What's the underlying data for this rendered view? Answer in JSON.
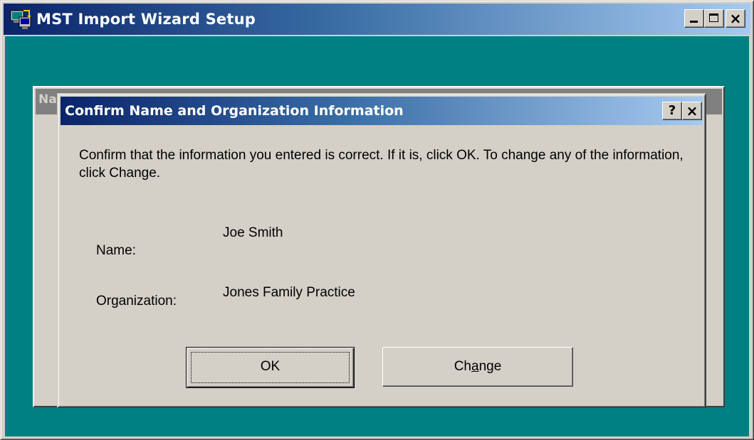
{
  "outer_window": {
    "title": "MST Import Wizard Setup",
    "app_icon": "setup-computer-icon",
    "minimize_icon": "minimize-icon",
    "maximize_icon": "maximize-icon",
    "close_icon": "close-icon",
    "close_glyph": "×"
  },
  "background_dialog": {
    "title_fragment": "Na"
  },
  "dialog": {
    "title": "Confirm Name and Organization Information",
    "help_glyph": "?",
    "close_glyph": "×",
    "help_icon": "help-icon",
    "close_icon": "close-icon",
    "message": "Confirm that the information you entered is correct. If it is, click OK. To change any of the information, click Change.",
    "fields": {
      "name_label": "Name:",
      "name_value": "Joe Smith",
      "organization_label": "Organization:",
      "organization_value": "Jones Family Practice"
    },
    "buttons": {
      "ok_label": "OK",
      "change_label_before": "Ch",
      "change_label_mnemonic": "a",
      "change_label_after": "nge"
    }
  },
  "colors": {
    "desktop_teal": "#008080",
    "active_title_start": "#0a246a",
    "active_title_end": "#a6caf0",
    "face": "#d4d0c8",
    "inactive_title": "#808080"
  }
}
